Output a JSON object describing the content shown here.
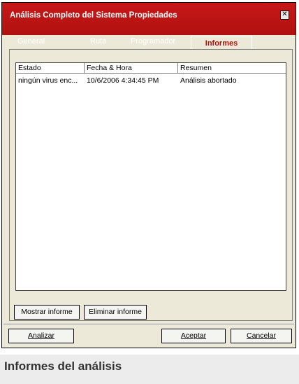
{
  "window": {
    "title": "Análisis Completo del Sistema Propiedades",
    "close_glyph": "✕"
  },
  "tabs": [
    {
      "label": "General",
      "active": false
    },
    {
      "label": "Ruta",
      "active": false
    },
    {
      "label": "Programador",
      "active": false
    },
    {
      "label": "Informes",
      "active": true
    }
  ],
  "table": {
    "columns": [
      "Estado",
      "Fecha & Hora",
      "Resumen"
    ],
    "rows": [
      {
        "estado": "ningún virus enc...",
        "fecha": "10/6/2006 4:34:45 PM",
        "resumen": "Análisis abortado"
      }
    ]
  },
  "buttons": {
    "show_report": "Mostrar informe",
    "delete_report": "Eliminar informe",
    "analyze": "Analizar",
    "accept": "Aceptar",
    "cancel": "Cancelar"
  },
  "caption": "Informes del análisis",
  "colors": {
    "titlebar": "#b01010",
    "dialog_bg": "#ece9d8",
    "active_tab_text": "#b01010"
  }
}
